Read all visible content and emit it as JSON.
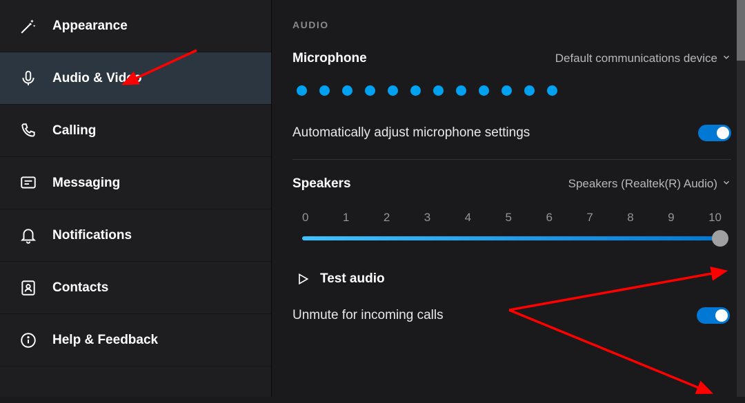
{
  "sidebar": {
    "items": [
      {
        "label": "Appearance",
        "icon": "wand-icon"
      },
      {
        "label": "Audio & Video",
        "icon": "microphone-icon",
        "active": true
      },
      {
        "label": "Calling",
        "icon": "phone-icon"
      },
      {
        "label": "Messaging",
        "icon": "message-icon"
      },
      {
        "label": "Notifications",
        "icon": "bell-icon"
      },
      {
        "label": "Contacts",
        "icon": "contacts-icon"
      },
      {
        "label": "Help & Feedback",
        "icon": "info-icon"
      }
    ]
  },
  "main": {
    "section_header": "AUDIO",
    "microphone": {
      "title": "Microphone",
      "device": "Default communications device",
      "level_dots": 12
    },
    "auto_adjust": {
      "label": "Automatically adjust microphone settings",
      "enabled": true
    },
    "speakers": {
      "title": "Speakers",
      "device": "Speakers (Realtek(R) Audio)",
      "scale": [
        "0",
        "1",
        "2",
        "3",
        "4",
        "5",
        "6",
        "7",
        "8",
        "9",
        "10"
      ],
      "value": 10
    },
    "test_audio": {
      "label": "Test audio"
    },
    "unmute_incoming": {
      "label": "Unmute for incoming calls",
      "enabled": true
    }
  },
  "colors": {
    "accent": "#0078d4",
    "dot": "#00a1f1",
    "annotation": "#ff0000"
  }
}
